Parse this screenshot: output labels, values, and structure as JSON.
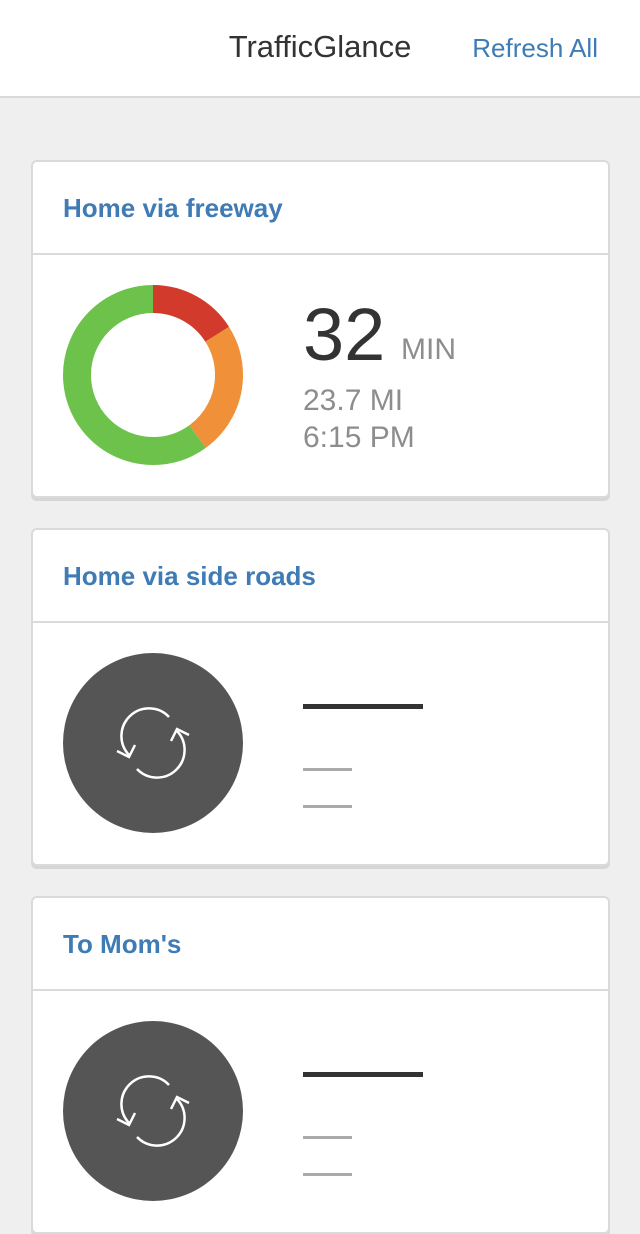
{
  "header": {
    "title": "TrafficGlance",
    "refresh_label": "Refresh All"
  },
  "colors": {
    "accent": "#3f7bb5",
    "segment_green": "#6cc24a",
    "segment_orange": "#f0913a",
    "segment_red": "#d23a2c",
    "loading_circle": "#555555"
  },
  "routes": [
    {
      "title": "Home via freeway",
      "state": "loaded",
      "minutes": "32",
      "minutes_unit": "MIN",
      "distance": "23.7 MI",
      "arrival": "6:15 PM",
      "traffic_breakdown": [
        {
          "level": "heavy",
          "color": "#d23a2c",
          "fraction": 0.16
        },
        {
          "level": "moderate",
          "color": "#f0913a",
          "fraction": 0.24
        },
        {
          "level": "light",
          "color": "#6cc24a",
          "fraction": 0.6
        }
      ]
    },
    {
      "title": "Home via side roads",
      "state": "loading",
      "icon": "refresh-icon"
    },
    {
      "title": "To Mom's",
      "state": "loading",
      "icon": "refresh-icon"
    }
  ]
}
